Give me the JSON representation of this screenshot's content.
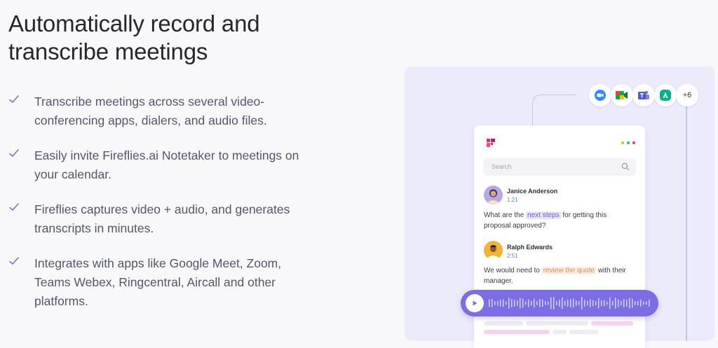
{
  "headline": "Automatically record and transcribe meetings",
  "features": [
    "Transcribe meetings across several video-conferencing apps, dialers, and audio files.",
    "Easily invite Fireflies.ai Notetaker to meetings on your calendar.",
    "Fireflies captures video + audio, and generates transcripts in minutes.",
    "Integrates with apps like Google Meet, Zoom, Teams Webex, Ringcentral, Aircall and other platforms."
  ],
  "integrations": {
    "icons": [
      "zoom-icon",
      "google-meet-icon",
      "microsoft-teams-icon",
      "aircall-icon"
    ],
    "more_label": "+6"
  },
  "mockup": {
    "search_placeholder": "Search",
    "messages": [
      {
        "name": "Janice Anderson",
        "time": "1:21",
        "text_before": "What are the ",
        "highlight": "next steps",
        "text_after": " for getting this proposal approved?"
      },
      {
        "name": "Ralph Edwards",
        "time": "2:51",
        "text_before": "We would need to ",
        "highlight": "review the quote",
        "text_after": " with their manager."
      }
    ]
  },
  "colors": {
    "accent": "#7b6de3",
    "panel_bg": "#ecebfb",
    "check": "#7a70d9",
    "highlight_purple": "#6a5fd8",
    "highlight_orange": "#e88b55",
    "time": "#4f8ad8"
  }
}
